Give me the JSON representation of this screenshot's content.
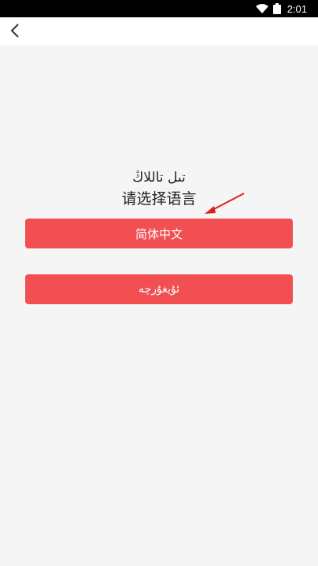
{
  "status_bar": {
    "time": "2:01",
    "wifi_icon": "wifi-icon",
    "battery_icon": "battery-icon"
  },
  "nav": {
    "back_icon": "chevron-left-icon"
  },
  "prompt": {
    "uyghur": "تىل تاللاڭ",
    "chinese": "请选择语言"
  },
  "languages": [
    {
      "label": "简体中文"
    },
    {
      "label": "ئۇيغۇرچە"
    }
  ],
  "colors": {
    "button": "#f24f53",
    "annotation_arrow": "#e02020",
    "background": "#f5f5f5"
  }
}
